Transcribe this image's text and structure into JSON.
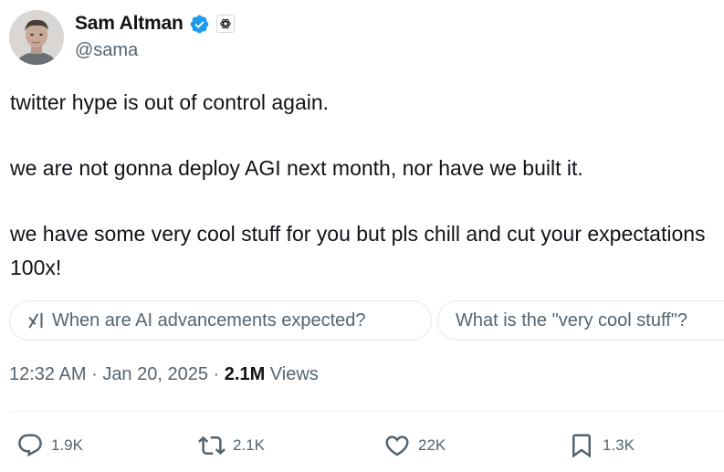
{
  "author": {
    "display_name": "Sam Altman",
    "handle": "@sama",
    "verified": true,
    "verified_color": "#1d9bf0",
    "affiliate_badge_icon": "openai-logo-icon",
    "avatar_icon": "profile-photo-avatar"
  },
  "tweet": {
    "paragraphs": [
      "twitter hype is out of control again.",
      "we are not gonna deploy AGI next month, nor have we built it.",
      "we have some very cool stuff for you but pls chill and cut your expectations 100x!"
    ]
  },
  "grok_suggestions": [
    {
      "label": "When are AI advancements expected?",
      "icon": "grok-icon"
    },
    {
      "label": "What is the \"very cool stuff\"?",
      "icon": ""
    }
  ],
  "meta": {
    "time": "12:32 AM",
    "separator": "·",
    "date": "Jan 20, 2025",
    "views_count": "2.1M",
    "views_label": "Views"
  },
  "actions": {
    "reply": {
      "count": "1.9K",
      "icon": "reply-icon"
    },
    "retweet": {
      "count": "2.1K",
      "icon": "retweet-icon"
    },
    "like": {
      "count": "22K",
      "icon": "heart-icon"
    },
    "bookmark": {
      "count": "1.3K",
      "icon": "bookmark-icon"
    }
  },
  "colors": {
    "text_primary": "#0f1419",
    "text_secondary": "#536471",
    "border": "#e1e8ed"
  }
}
